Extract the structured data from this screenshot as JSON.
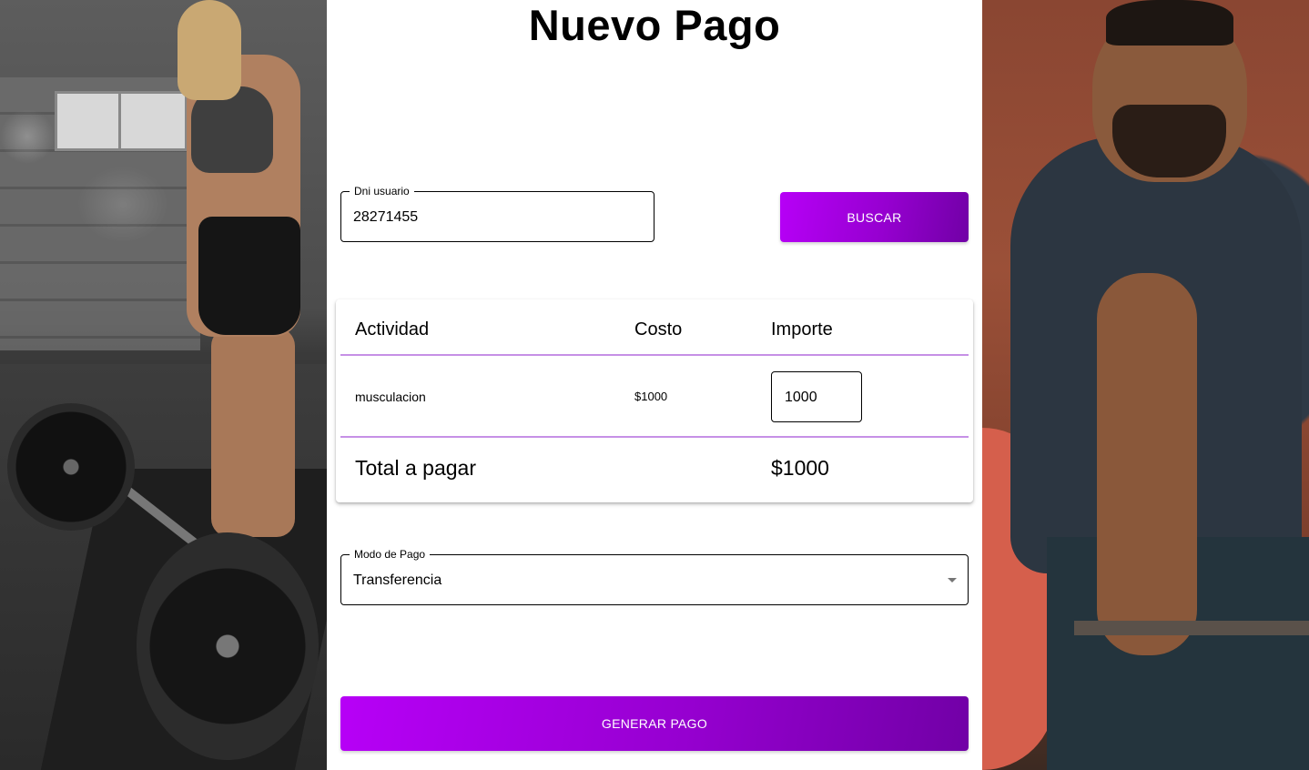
{
  "page": {
    "title": "Nuevo Pago"
  },
  "search": {
    "dni_label": "Dni usuario",
    "dni_value": "28271455",
    "button_label": "BUSCAR"
  },
  "table": {
    "headers": [
      "Actividad",
      "Costo",
      "Importe"
    ],
    "rows": [
      {
        "actividad": "musculacion",
        "costo": "$1000",
        "importe": "1000"
      }
    ],
    "total_label": "Total a pagar",
    "total_value": "$1000"
  },
  "payment": {
    "mode_label": "Modo de Pago",
    "mode_value": "Transferencia",
    "submit_label": "GENERAR PAGO"
  },
  "colors": {
    "accent_start": "#b700f7",
    "accent_end": "#7100a6",
    "divider": "#c690e6"
  },
  "icons": {
    "dropdown": "chevron-down-icon"
  }
}
